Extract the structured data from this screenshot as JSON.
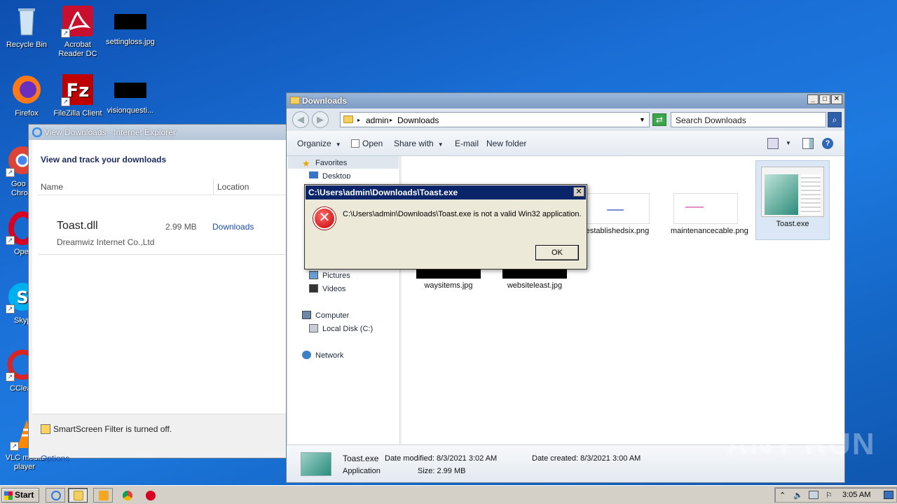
{
  "desktop": {
    "icons": [
      {
        "label": "Recycle Bin"
      },
      {
        "label": "Acrobat Reader DC"
      },
      {
        "label": "settingloss.jpg"
      },
      {
        "label": "Firefox"
      },
      {
        "label": "FileZilla Client"
      },
      {
        "label": "visionquesti..."
      },
      {
        "label": "Goo Chro"
      },
      {
        "label": "Ope"
      },
      {
        "label": "Skyp"
      },
      {
        "label": "CClea"
      },
      {
        "label": "VLC media player"
      }
    ]
  },
  "ie_downloads": {
    "title": "View Downloads - Internet Explorer",
    "heading": "View and track your downloads",
    "col_name": "Name",
    "col_location": "Location",
    "item": {
      "name": "Toast.dll",
      "size": "2.99 MB",
      "location": "Downloads",
      "publisher": "Dreamwiz Internet Co.,Ltd"
    },
    "smartscreen": "SmartScreen Filter is turned off.",
    "options": "Options"
  },
  "explorer": {
    "title": "Downloads",
    "breadcrumb": [
      "admin",
      "Downloads"
    ],
    "search_placeholder": "Search Downloads",
    "toolbar": {
      "organize": "Organize",
      "open": "Open",
      "share_with": "Share with",
      "email": "E-mail",
      "new_folder": "New folder"
    },
    "nav": {
      "favorites": "Favorites",
      "desktop": "Desktop",
      "pictures": "Pictures",
      "videos": "Videos",
      "computer": "Computer",
      "local_disk": "Local Disk (C:)",
      "network": "Network"
    },
    "files": [
      {
        "name": "establishedsix.png"
      },
      {
        "name": "maintenancecable.png"
      },
      {
        "name": "Toast.exe"
      },
      {
        "name": "waysitems.jpg"
      },
      {
        "name": "websiteleast.jpg"
      }
    ],
    "details": {
      "name": "Toast.exe",
      "type": "Application",
      "date_modified": "Date modified: 8/3/2021 3:02 AM",
      "date_created": "Date created: 8/3/2021 3:00 AM",
      "size": "Size: 2.99 MB"
    }
  },
  "error_dialog": {
    "title": "C:\\Users\\admin\\Downloads\\Toast.exe",
    "message": "C:\\Users\\admin\\Downloads\\Toast.exe is not a valid Win32 application.",
    "ok": "OK"
  },
  "taskbar": {
    "start": "Start",
    "clock": "3:05 AM"
  },
  "watermark": "ANY RUN"
}
